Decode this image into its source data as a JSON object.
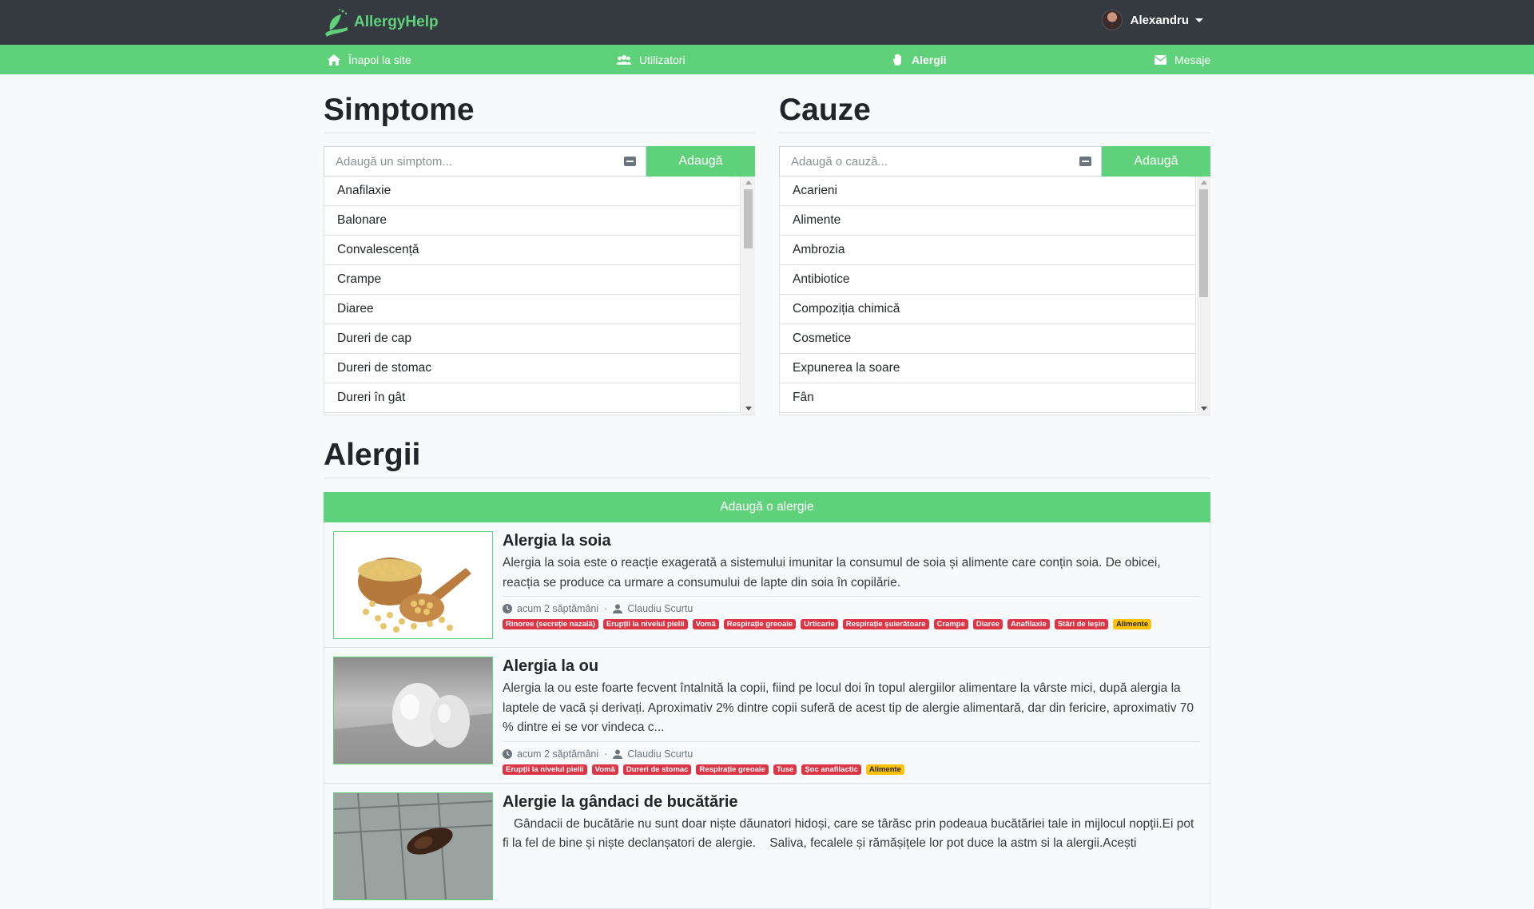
{
  "brand": {
    "name": "AllergyHelp"
  },
  "user": {
    "name": "Alexandru"
  },
  "nav": {
    "items": [
      {
        "label": "Înapoi la site",
        "icon": "home-icon"
      },
      {
        "label": "Utilizatori",
        "icon": "users-icon"
      },
      {
        "label": "Alergii",
        "icon": "hand-icon",
        "active": true
      },
      {
        "label": "Mesaje",
        "icon": "envelope-icon"
      }
    ]
  },
  "symptoms": {
    "title": "Simptome",
    "placeholder": "Adaugă un simptom...",
    "add_label": "Adaugă",
    "items": [
      "Anafilaxie",
      "Balonare",
      "Convalescență",
      "Crampe",
      "Diaree",
      "Dureri de cap",
      "Dureri de stomac",
      "Dureri în gât"
    ]
  },
  "causes": {
    "title": "Cauze",
    "placeholder": "Adaugă o cauză...",
    "add_label": "Adaugă",
    "items": [
      "Acarieni",
      "Alimente",
      "Ambrozia",
      "Antibiotice",
      "Compoziția chimică",
      "Cosmetice",
      "Expunerea la soare",
      "Fân"
    ]
  },
  "allergies": {
    "title": "Alergii",
    "add_label": "Adaugă o alergie",
    "cards": [
      {
        "title": "Alergia la soia",
        "text": "Alergia la soia este o reacție exagerată a sistemului imunitar la consumul de soia și alimente care conțin soia. De obicei, reacția se produce ca urmare a consumului de lapte din soia în copilărie.",
        "time": "acum 2 săptămâni",
        "author": "Claudiu Scurtu",
        "symptom_tags": [
          "Rinoree (secreție nazală)",
          "Erupții la nivelul pielii",
          "Vomă",
          "Respirație greoaie",
          "Urticarie",
          "Respirație șuierătoare",
          "Crampe",
          "Diaree",
          "Anafilaxie",
          "Stări de leșin"
        ],
        "cause_tags": [
          "Alimente"
        ],
        "image": "soybeans"
      },
      {
        "title": "Alergia la ou",
        "text": "Alergia la ou este foarte fecvent întalnită la copii, fiind pe locul doi în topul alergiilor alimentare la vârste mici, după alergia la laptele de vacă și derivați. Aproximativ 2% dintre copii suferă de acest tip de alergie alimentară, dar din fericire, aproximativ 70 % dintre ei se vor vindeca c...",
        "time": "acum 2 săptămâni",
        "author": "Claudiu Scurtu",
        "symptom_tags": [
          "Erupții la nivelul pielii",
          "Vomă",
          "Dureri de stomac",
          "Respirație greoaie",
          "Tuse",
          "Șoc anafilactic"
        ],
        "cause_tags": [
          "Alimente"
        ],
        "image": "eggs"
      },
      {
        "title": "Alergie la gândaci de bucătărie",
        "text": "Gândacii de bucătărie nu sunt doar niște dăunatori hidoși, care se târăsc prin podeaua bucătăriei tale in mijlocul nopții.Ei pot fi la fel de bine și niște declanșatori de alergie.    Saliva, fecalele și rămășițele lor pot duce la astm si la alergii.Acești",
        "image": "cockroach"
      }
    ]
  },
  "colors": {
    "accent": "#5fd17a",
    "topbar": "#343a40",
    "danger": "#dc3545",
    "warning": "#ffc107"
  }
}
